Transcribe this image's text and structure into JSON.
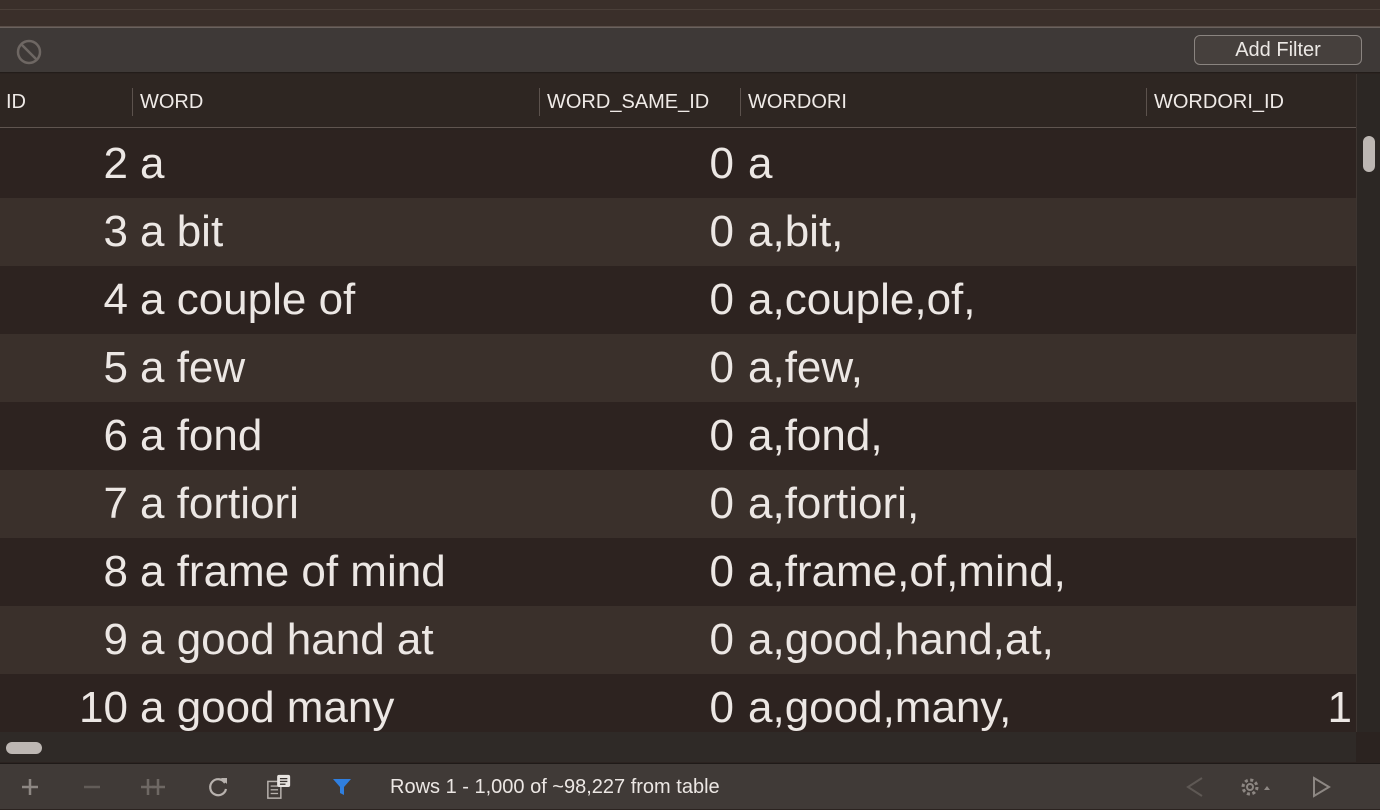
{
  "filter_bar": {
    "add_filter_label": "Add Filter"
  },
  "columns": [
    {
      "key": "id",
      "label": "ID"
    },
    {
      "key": "word",
      "label": "WORD"
    },
    {
      "key": "word_same_id",
      "label": "WORD_SAME_ID"
    },
    {
      "key": "wordori",
      "label": "WORDORI"
    },
    {
      "key": "wordori_id",
      "label": "WORDORI_ID"
    }
  ],
  "rows": [
    {
      "id": "2",
      "word": "a",
      "word_same_id": "0",
      "wordori": "a",
      "wordori_id": ""
    },
    {
      "id": "3",
      "word": "a bit",
      "word_same_id": "0",
      "wordori": "a,bit,",
      "wordori_id": ""
    },
    {
      "id": "4",
      "word": "a couple of",
      "word_same_id": "0",
      "wordori": "a,couple,of,",
      "wordori_id": ""
    },
    {
      "id": "5",
      "word": "a few",
      "word_same_id": "0",
      "wordori": "a,few,",
      "wordori_id": ""
    },
    {
      "id": "6",
      "word": "a fond",
      "word_same_id": "0",
      "wordori": "a,fond,",
      "wordori_id": ""
    },
    {
      "id": "7",
      "word": "a fortiori",
      "word_same_id": "0",
      "wordori": "a,fortiori,",
      "wordori_id": ""
    },
    {
      "id": "8",
      "word": "a frame of mind",
      "word_same_id": "0",
      "wordori": "a,frame,of,mind,",
      "wordori_id": ""
    },
    {
      "id": "9",
      "word": "a good hand at",
      "word_same_id": "0",
      "wordori": "a,good,hand,at,",
      "wordori_id": ""
    },
    {
      "id": "10",
      "word": "a good many",
      "word_same_id": "0",
      "wordori": "a,good,many,",
      "wordori_id": "1"
    }
  ],
  "status_bar": {
    "text": "Rows 1 - 1,000 of ~98,227 from table"
  },
  "icons": {
    "clear_filter": "clear-filter-icon",
    "add_row": "plus-icon",
    "remove_row": "minus-icon",
    "duplicate_row": "duplicate-row-icon",
    "refresh": "refresh-icon",
    "query_log": "query-log-icon",
    "filter": "filter-funnel-icon",
    "previous_page": "chevron-left-icon",
    "settings": "gear-icon",
    "next_page": "chevron-right-icon"
  },
  "colors": {
    "background": "#2b2320",
    "row_odd": "#2d2320",
    "row_even": "#3a302b",
    "accent_filter": "#2f7fe0",
    "text": "#ece7e4"
  }
}
